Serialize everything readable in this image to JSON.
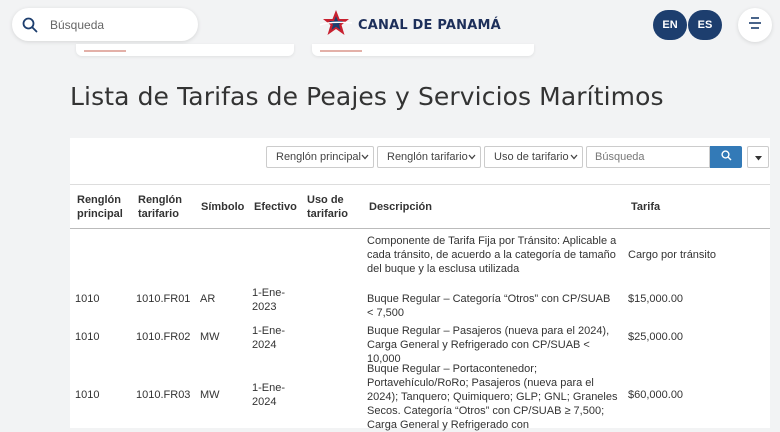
{
  "header": {
    "search_placeholder": "Búsqueda",
    "logo_text": "CANAL DE PANAMÁ",
    "lang_en": "EN",
    "lang_es": "ES"
  },
  "page_title": "Lista de Tarifas de Peajes y Servicios Marítimos",
  "filters": {
    "renglon_principal": "Renglón principal",
    "renglon_tarifario": "Renglón tarifario",
    "uso_de_tarifario": "Uso de tarifario",
    "search_placeholder": "Búsqueda"
  },
  "table": {
    "headers": {
      "principal": "Renglón principal",
      "tarifario": "Renglón tarifario",
      "simbolo": "Símbolo",
      "efectivo": "Efectivo",
      "uso": "Uso de tarifario",
      "descripcion": "Descripción",
      "tarifa": "Tarifa"
    },
    "rows": [
      {
        "principal": "",
        "tarifario": "",
        "simbolo": "",
        "efectivo": "",
        "uso": "",
        "descripcion": "Componente de Tarifa Fija por Tránsito: Aplicable a cada tránsito, de acuerdo a la categoría de tamaño del buque y la esclusa utilizada",
        "tarifa": "Cargo por tránsito"
      },
      {
        "principal": "1010",
        "tarifario": "1010.FR01",
        "simbolo": "AR",
        "efectivo": "1-Ene-2023",
        "uso": "",
        "descripcion": "Buque Regular – Categoría “Otros” con CP/SUAB < 7,500",
        "tarifa": "$15,000.00"
      },
      {
        "principal": "1010",
        "tarifario": "1010.FR02",
        "simbolo": "MW",
        "efectivo": "1-Ene-2024",
        "uso": "",
        "descripcion": "Buque Regular – Pasajeros (nueva para el 2024), Carga General y Refrigerado con CP/SUAB < 10,000",
        "tarifa": "$25,000.00"
      },
      {
        "principal": "1010",
        "tarifario": "1010.FR03",
        "simbolo": "MW",
        "efectivo": "1-Ene-2024",
        "uso": "",
        "descripcion": "Buque Regular – Portacontenedor; Portavehículo/RoRo; Pasajeros (nueva para el 2024); Tanquero; Quimiquero; GLP; GNL; Graneles Secos. Categoría “Otros” con CP/SUAB ≥ 7,500; Carga General y Refrigerado con",
        "tarifa": "$60,000.00"
      }
    ]
  }
}
